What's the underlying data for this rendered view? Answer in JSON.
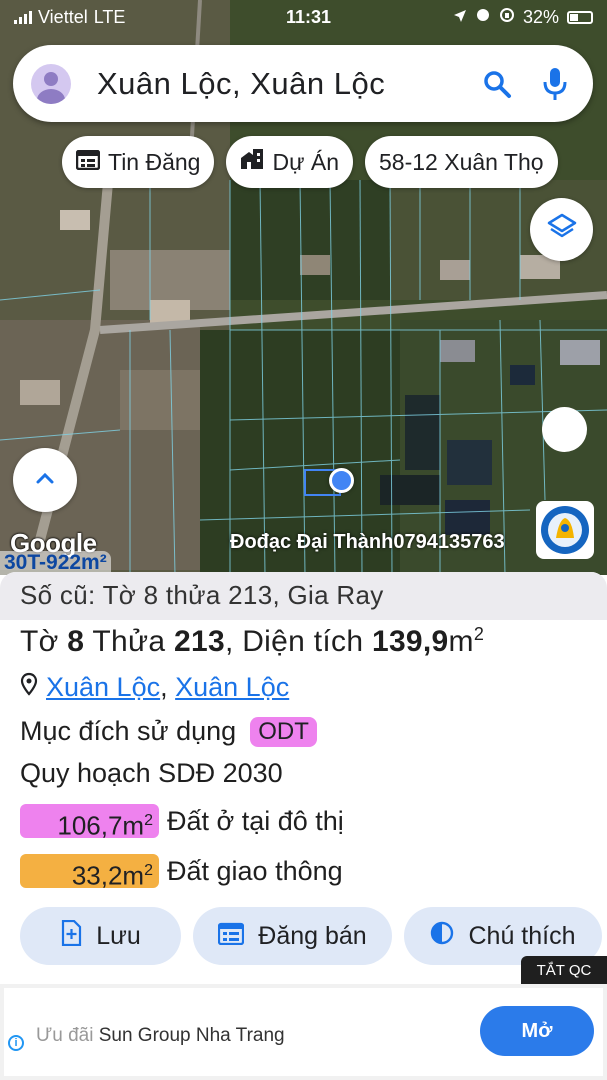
{
  "status_bar": {
    "carrier": "Viettel",
    "network": "LTE",
    "time": "11:31",
    "battery": "32%"
  },
  "search": {
    "query": "Xuân Lộc, Xuân Lộc"
  },
  "chips": [
    {
      "label": "Tin Đăng",
      "icon": "listing-icon"
    },
    {
      "label": "Dự Án",
      "icon": "building-icon"
    },
    {
      "label": "58-12 Xuân Thọ",
      "icon": ""
    }
  ],
  "map": {
    "google_label": "Google",
    "parcel_tag": "30T-922m²",
    "watermark": "Đođạc Đại Thành0794135763",
    "brand_name": "ĐẠI THÀNH"
  },
  "panel": {
    "old_info": "Số cũ: Tờ 8 thửa 213, Gia Ray",
    "sheet_label": "Tờ",
    "sheet_no": "8",
    "plot_label": "Thửa",
    "plot_no": "213",
    "area_label": "Diện tích",
    "area_value": "139,9",
    "area_unit": "m",
    "area_sup": "2",
    "location_1": "Xuân Lộc",
    "location_sep": ",",
    "location_2": "Xuân Lộc",
    "purpose_label": "Mục đích sử dụng",
    "purpose_code": "ODT",
    "plan_label": "Quy hoạch SDĐ 2030",
    "areas": [
      {
        "value": "106,7m",
        "sup": "2",
        "label": "Đất ở tại đô thị",
        "color": "#ee82ee"
      },
      {
        "value": "33,2m",
        "sup": "2",
        "label": "Đất giao thông",
        "color": "#f4b042"
      }
    ],
    "actions": [
      {
        "label": "Lưu",
        "icon": "bookmark-add-icon"
      },
      {
        "label": "Đăng bán",
        "icon": "calendar-list-icon"
      },
      {
        "label": "Chú thích",
        "icon": "half-circle-icon"
      }
    ]
  },
  "ad": {
    "close_label": "TẮT QC",
    "text": "Sun Group Nha Trang",
    "prefix": "Ưu đãi",
    "button": "Mở"
  },
  "colors": {
    "accent": "#1a73e8",
    "odt_badge": "#ee82ee",
    "traffic": "#f4b042",
    "button_bg": "#dfe8f7"
  }
}
